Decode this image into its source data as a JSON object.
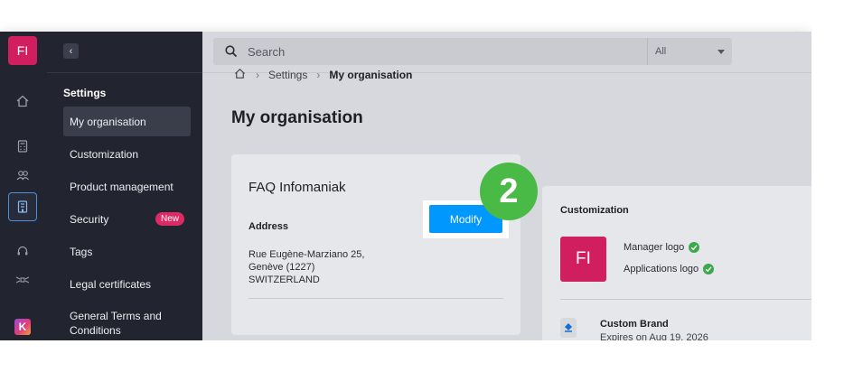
{
  "rail": {
    "avatar_initials": "FI",
    "icons": [
      "home-icon",
      "calculator-icon",
      "users-icon",
      "building-icon",
      "headset-icon",
      "satellite-icon"
    ],
    "app_logo": "K"
  },
  "sidebar": {
    "section_title": "Settings",
    "items": [
      {
        "label": "My organisation",
        "active": true
      },
      {
        "label": "Customization"
      },
      {
        "label": "Product management"
      },
      {
        "label": "Security",
        "badge": "New"
      },
      {
        "label": "Tags"
      },
      {
        "label": "Legal certificates"
      },
      {
        "label": "General Terms and Conditions"
      }
    ]
  },
  "search": {
    "placeholder": "Search",
    "filter_value": "All"
  },
  "breadcrumb": {
    "items": [
      "Settings",
      "My organisation"
    ]
  },
  "page": {
    "title": "My organisation"
  },
  "org_card": {
    "name": "FAQ Infomaniak",
    "modify_label": "Modify",
    "address_label": "Address",
    "address_lines": [
      "Rue Eugène-Marziano 25,",
      "Genève (1227)",
      "SWITZERLAND"
    ]
  },
  "step_marker": "2",
  "customization_card": {
    "title": "Customization",
    "logo_initials": "FI",
    "items": [
      "Manager logo",
      "Applications logo"
    ],
    "brand_name": "Custom Brand",
    "brand_expiry": "Expires on Aug 19, 2026"
  },
  "colors": {
    "accent": "#0098ff",
    "brand": "#d11e5e",
    "success": "#3ba84a",
    "step": "#48ba45",
    "badge": "#dd2a64"
  }
}
